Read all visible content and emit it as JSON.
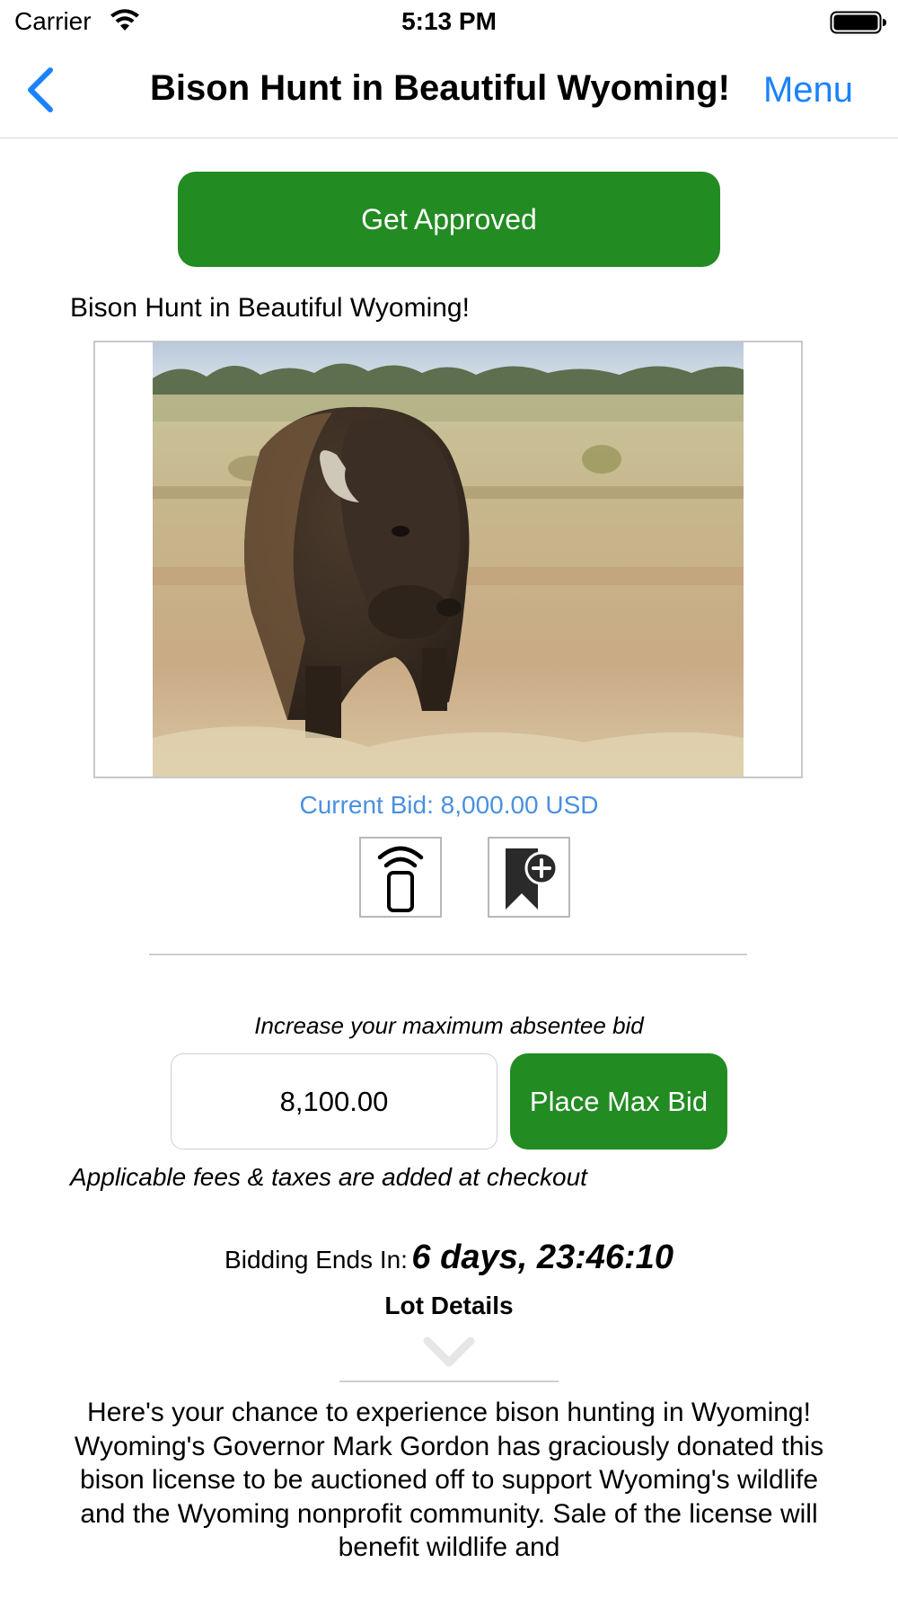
{
  "status_bar": {
    "carrier": "Carrier",
    "time": "5:13 PM",
    "icons": [
      "wifi-icon",
      "battery-icon"
    ]
  },
  "nav": {
    "back_icon": "chevron-left-icon",
    "title": "Bison Hunt in Beautiful Wyoming!",
    "menu_label": "Menu"
  },
  "colors": {
    "accent_blue": "#1a82fb",
    "bid_blue": "#4a90e2",
    "button_green": "#228b22"
  },
  "approve_label": "Get Approved",
  "lot": {
    "title": "Bison Hunt in Beautiful Wyoming!",
    "image_subject": "bison-photo",
    "current_bid": "Current Bid: 8,000.00 USD",
    "action_icons": [
      "remote-bidding-icon",
      "watchlist-add-icon"
    ]
  },
  "bid": {
    "increase_label": "Increase your maximum absentee bid",
    "input_value": "8,100.00",
    "place_label": "Place Max Bid",
    "fees_note": "Applicable fees & taxes are added at checkout"
  },
  "countdown": {
    "label": "Bidding Ends In:",
    "value": "6 days, 23:46:10"
  },
  "details": {
    "heading": "Lot Details",
    "toggle_icon": "chevron-down-icon",
    "paragraph_1": "Here's your chance to experience bison hunting in Wyoming!",
    "paragraph_2": "Wyoming's Governor Mark Gordon has graciously donated this bison license to be auctioned off to support Wyoming's wildlife and the Wyoming nonprofit community. Sale of the license will benefit wildlife and"
  }
}
